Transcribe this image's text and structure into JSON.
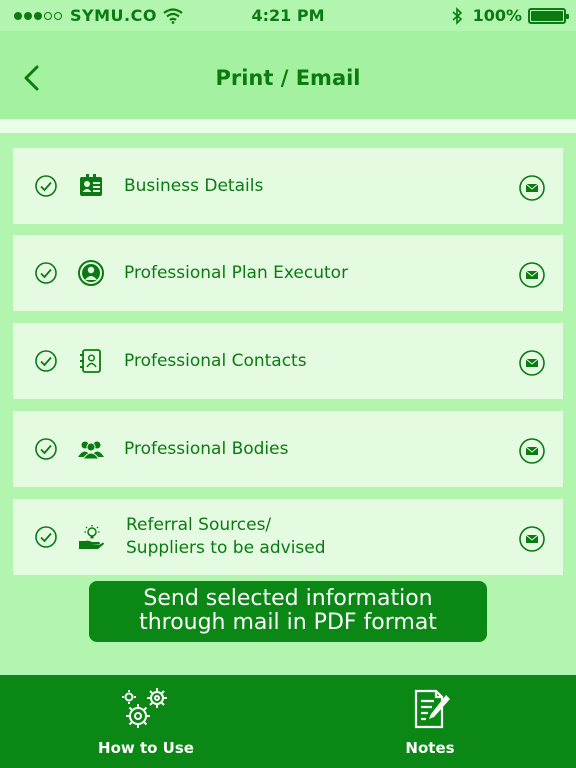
{
  "status_bar": {
    "carrier": "SYMU.CO",
    "time": "4:21 PM",
    "battery_percent": "100%",
    "signal_bars_filled": 3,
    "signal_bars_total": 5
  },
  "header": {
    "title": "Print / Email",
    "back_icon": "chevron-left-icon"
  },
  "items": [
    {
      "label": "Business Details",
      "icon": "id-card-icon",
      "checked": true
    },
    {
      "label": "Professional Plan Executor",
      "icon": "user-circle-icon",
      "checked": true
    },
    {
      "label": "Professional Contacts",
      "icon": "address-book-icon",
      "checked": true
    },
    {
      "label": "Professional Bodies",
      "icon": "group-icon",
      "checked": true
    },
    {
      "label_line1": "Referral Sources/",
      "label_line2": "Suppliers to be advised",
      "icon": "hand-lightbulb-icon",
      "checked": true
    }
  ],
  "send_button": {
    "line1": "Send selected information",
    "line2": "through mail in PDF format"
  },
  "tab_bar": {
    "how_to_use": "How to Use",
    "notes": "Notes"
  },
  "colors": {
    "background": "#b2f5ae",
    "header": "#a4f1a0",
    "row": "#e4fbe2",
    "accent": "#0a8714",
    "text": "#0c7a12"
  }
}
